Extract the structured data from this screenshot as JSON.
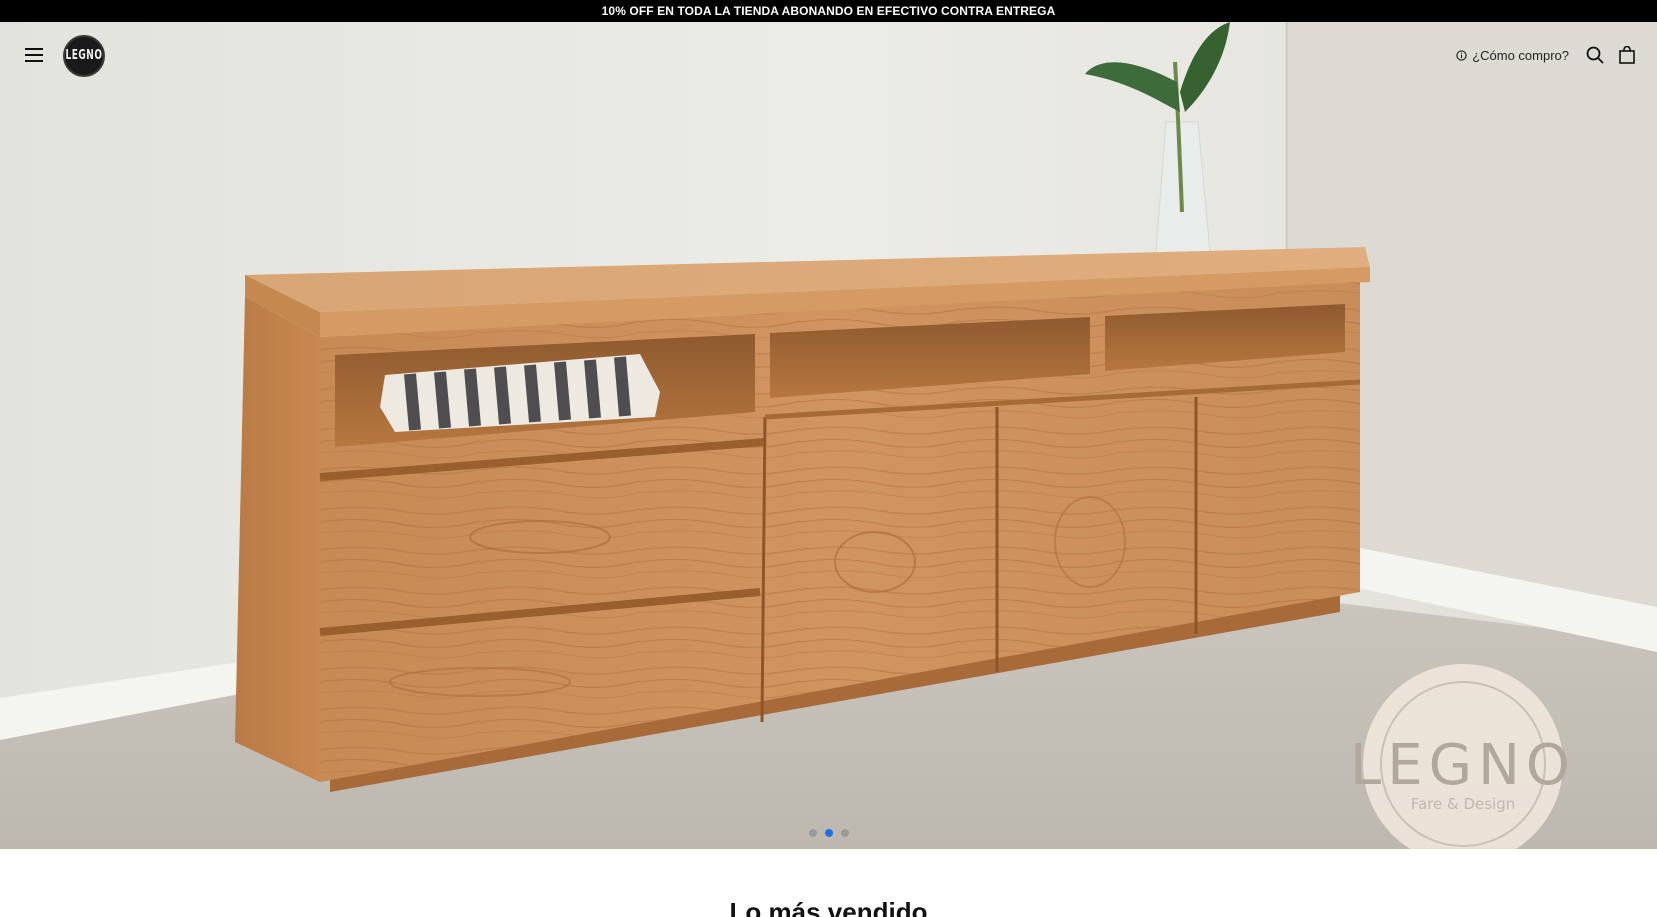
{
  "announcement": {
    "text": "10% OFF EN TODA LA TIENDA ABONANDO EN EFECTIVO CONTRA ENTREGA"
  },
  "header": {
    "logo_text": "LEGNO",
    "how_to_buy_label": "¿Cómo compro?",
    "menu_icon": "hamburger-icon",
    "info_icon": "info-icon",
    "search_icon": "search-icon",
    "cart_icon": "shopping-bag-icon"
  },
  "hero": {
    "watermark_brand": "LEGNO",
    "watermark_tagline": "Fare & Design",
    "slides_count": 3,
    "active_slide": 2
  },
  "bestsellers": {
    "title": "Lo más vendido"
  },
  "colors": {
    "announcement_bg": "#000000",
    "active_dot": "#1f6fe5",
    "inactive_dot": "#9a9a9a"
  }
}
